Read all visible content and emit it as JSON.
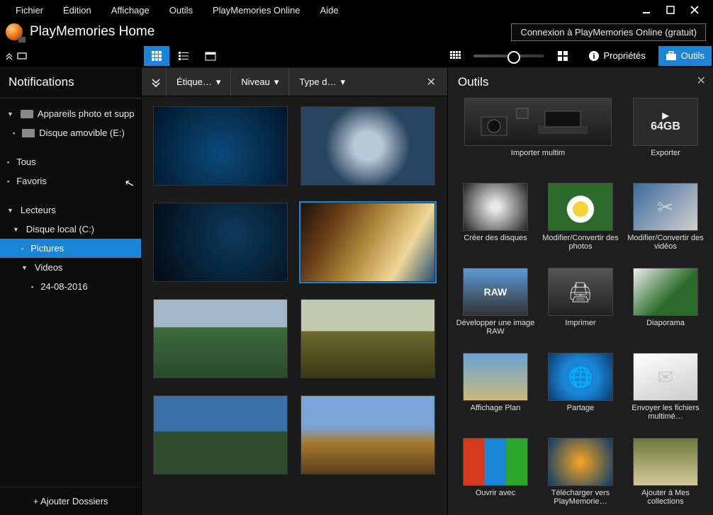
{
  "menubar": {
    "file": "Fichier",
    "edit": "Édition",
    "view": "Affichage",
    "tools": "Outils",
    "pmo": "PlayMemories Online",
    "help": "Aide"
  },
  "app": {
    "title": "PlayMemories Home",
    "login_button": "Connexion à PlayMemories Online (gratuit)"
  },
  "toolbar": {
    "properties": "Propriétés",
    "tools": "Outils"
  },
  "sidebar": {
    "title": "Notifications",
    "devices_header": "Appareils photo et supp",
    "removable_disk": "Disque amovible (E:)",
    "all": "Tous",
    "favorites": "Favoris",
    "drives_header": "Lecteurs",
    "local_disk": "Disque local (C:)",
    "pictures": "Pictures",
    "videos": "Videos",
    "date_folder": "24-08-2016",
    "add_folder": "+ Ajouter Dossiers"
  },
  "filters": {
    "tags": "Étique…",
    "level": "Niveau",
    "type": "Type d…"
  },
  "rightpanel": {
    "title": "Outils",
    "tools": {
      "import": "Importer multim",
      "export": "Exporter",
      "export_badge": "64GB",
      "create_discs": "Créer des disques",
      "edit_photos": "Modifier/Convertir des photos",
      "edit_videos": "Modifier/Convertir des vidéos",
      "raw": "Développer une image RAW",
      "raw_badge": "RAW",
      "print": "Imprimer",
      "slideshow": "Diaporama",
      "map_view": "Affichage Plan",
      "share": "Partage",
      "send_files": "Envoyer les fichiers multimé…",
      "open_with": "Ouvrir avec",
      "upload_pmo": "Télécharger vers PlayMemorie…",
      "add_collections": "Ajouter à Mes collections"
    }
  }
}
